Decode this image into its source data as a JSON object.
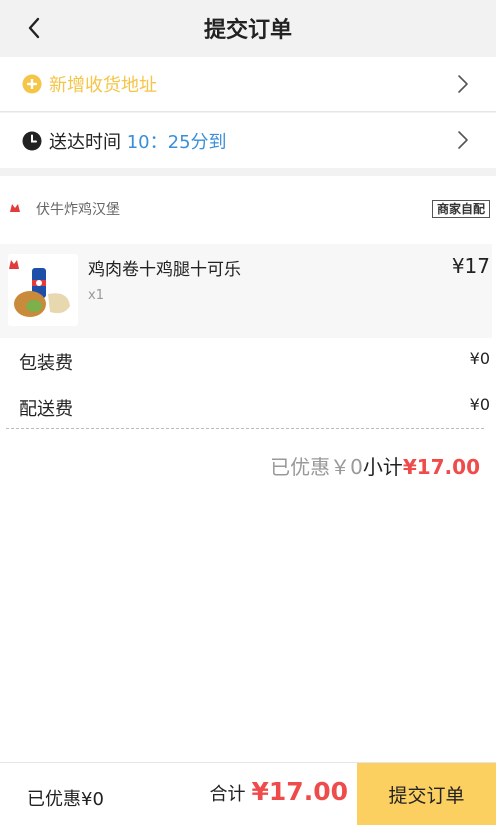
{
  "header": {
    "title": "提交订单"
  },
  "address": {
    "label": "新增收货地址"
  },
  "delivery_time": {
    "prefix": "送达时间",
    "hour": "10",
    "separator": "：",
    "minute_text": "25分到"
  },
  "shop": {
    "name": "伏牛炸鸡汉堡",
    "badge": "商家自配"
  },
  "item": {
    "name": "鸡肉卷十鸡腿十可乐",
    "qty": "x1",
    "price": "¥17"
  },
  "fees": [
    {
      "label": "包装费",
      "value": "¥0"
    },
    {
      "label": "配送费",
      "value": "¥0"
    }
  ],
  "subtotal": {
    "discount": "已优惠￥0",
    "label": "小计",
    "amount": "¥17.00"
  },
  "footer": {
    "discount": "已优惠¥0",
    "total_label": "合计",
    "total_amount": "¥17.00",
    "submit_label": "提交订单"
  },
  "colors": {
    "accent_yellow": "#fbd061",
    "address_yellow": "#f5c548",
    "price_red": "#f04b4b",
    "time_blue": "#3b8fd9"
  },
  "icons": {
    "back": "chevron-left-icon",
    "address": "plus-circle-icon",
    "time": "clock-icon",
    "row_arrow": "chevron-right-icon"
  }
}
